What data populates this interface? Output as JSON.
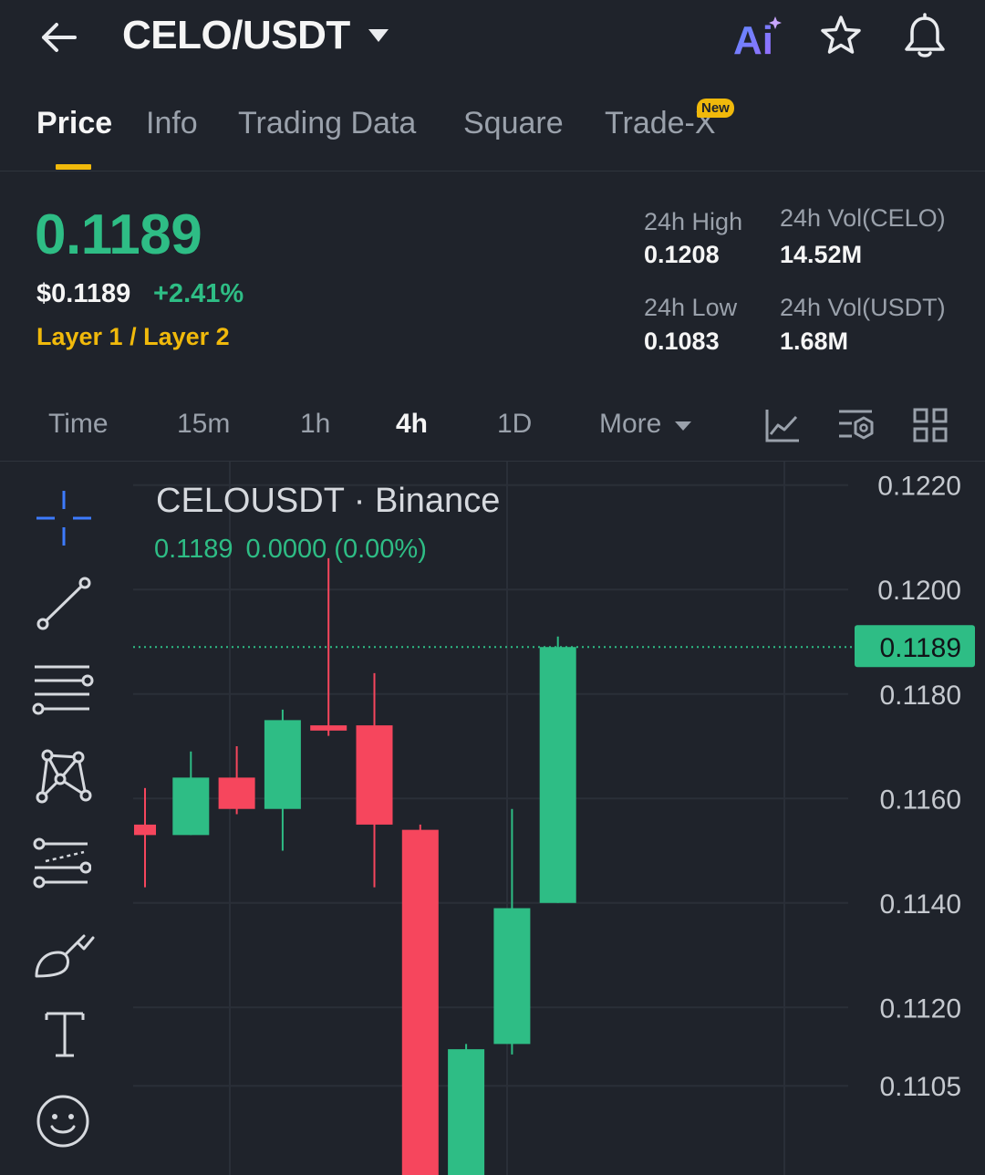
{
  "header": {
    "pair": "CELO/USDT",
    "icons": [
      "back-arrow-icon",
      "chevron-down-icon",
      "ai-icon",
      "star-icon",
      "bell-icon"
    ],
    "ai_label": "Ai"
  },
  "tabs": [
    {
      "label": "Price",
      "active": true
    },
    {
      "label": "Info"
    },
    {
      "label": "Trading Data"
    },
    {
      "label": "Square"
    },
    {
      "label": "Trade-X",
      "badge": "New"
    }
  ],
  "price": {
    "last": "0.1189",
    "usd": "$0.1189",
    "change_pct": "+2.41%",
    "sector": "Layer 1 / Layer 2"
  },
  "stats": {
    "high_label": "24h High",
    "high_value": "0.1208",
    "low_label": "24h Low",
    "low_value": "0.1083",
    "vol_base_label": "24h Vol(CELO)",
    "vol_base_value": "14.52M",
    "vol_quote_label": "24h Vol(USDT)",
    "vol_quote_value": "1.68M"
  },
  "intervals": {
    "items": [
      "Time",
      "15m",
      "1h",
      "4h",
      "1D",
      "More"
    ],
    "active": "4h",
    "tool_icons": [
      "line-chart-icon",
      "indicator-settings-icon",
      "grid-layout-icon"
    ]
  },
  "drawing_tools": [
    "crosshair-icon",
    "trend-line-icon",
    "horizontal-lines-icon",
    "pattern-icon",
    "fib-retracement-icon",
    "brush-icon",
    "text-icon",
    "emoji-icon"
  ],
  "chart": {
    "symbol_label": "CELOUSDT · Binance",
    "ohlc_price": "0.1189",
    "ohlc_change": "0.0000 (0.00%)",
    "current_price_tag": "0.1189"
  },
  "colors": {
    "up": "#2ebd85",
    "down": "#f6465d",
    "accent": "#f0b90b",
    "background": "#1f232b"
  },
  "chart_data": {
    "type": "candlestick",
    "title": "CELOUSDT · Binance",
    "interval": "4h",
    "y_ticks": [
      "0.1220",
      "0.1200",
      "0.1180",
      "0.1160",
      "0.1140",
      "0.1120",
      "0.1105"
    ],
    "ylim": [
      0.1097,
      0.1221
    ],
    "last_price": 0.1189,
    "candles": [
      {
        "open": 0.1155,
        "high": 0.1162,
        "low": 0.1143,
        "close": 0.1153
      },
      {
        "open": 0.1153,
        "high": 0.1169,
        "low": 0.1153,
        "close": 0.1164
      },
      {
        "open": 0.1164,
        "high": 0.117,
        "low": 0.1157,
        "close": 0.1158
      },
      {
        "open": 0.1158,
        "high": 0.1177,
        "low": 0.115,
        "close": 0.1175
      },
      {
        "open": 0.1174,
        "high": 0.1206,
        "low": 0.1172,
        "close": 0.1173
      },
      {
        "open": 0.1174,
        "high": 0.1184,
        "low": 0.1143,
        "close": 0.1155
      },
      {
        "open": 0.1154,
        "high": 0.1155,
        "low": 0.1083,
        "close": 0.1083
      },
      {
        "open": 0.1083,
        "high": 0.1113,
        "low": 0.1083,
        "close": 0.1112
      },
      {
        "open": 0.1113,
        "high": 0.1158,
        "low": 0.1111,
        "close": 0.1139
      },
      {
        "open": 0.114,
        "high": 0.1191,
        "low": 0.114,
        "close": 0.1189
      }
    ]
  }
}
